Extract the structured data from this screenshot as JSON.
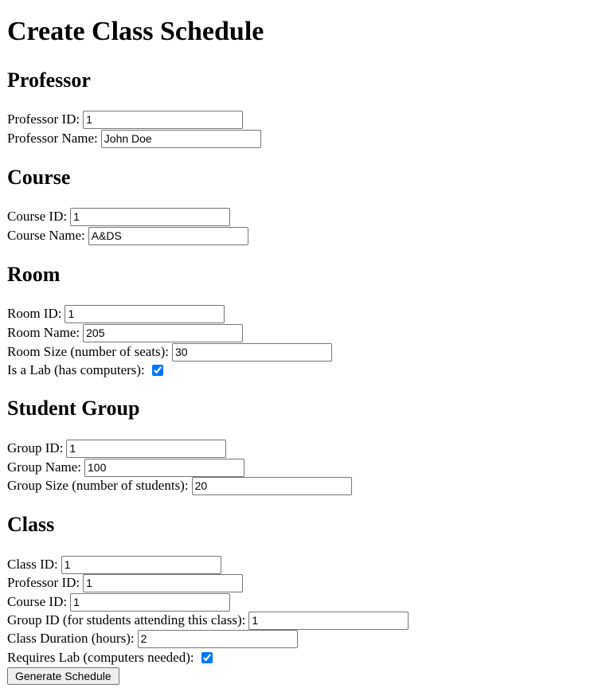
{
  "title": "Create Class Schedule",
  "professor": {
    "heading": "Professor",
    "id_label": "Professor ID:",
    "id_value": "1",
    "name_label": "Professor Name:",
    "name_value": "John Doe"
  },
  "course": {
    "heading": "Course",
    "id_label": "Course ID:",
    "id_value": "1",
    "name_label": "Course Name:",
    "name_value": "A&DS"
  },
  "room": {
    "heading": "Room",
    "id_label": "Room ID:",
    "id_value": "1",
    "name_label": "Room Name:",
    "name_value": "205",
    "size_label": "Room Size (number of seats):",
    "size_value": "30",
    "lab_label": "Is a Lab (has computers):",
    "lab_checked": true
  },
  "group": {
    "heading": "Student Group",
    "id_label": "Group ID:",
    "id_value": "1",
    "name_label": "Group Name:",
    "name_value": "100",
    "size_label": "Group Size (number of students):",
    "size_value": "20"
  },
  "class": {
    "heading": "Class",
    "id_label": "Class ID:",
    "id_value": "1",
    "professor_id_label": "Professor ID:",
    "professor_id_value": "1",
    "course_id_label": "Course ID:",
    "course_id_value": "1",
    "group_id_label": "Group ID (for students attending this class):",
    "group_id_value": "1",
    "duration_label": "Class Duration (hours):",
    "duration_value": "2",
    "requires_lab_label": "Requires Lab (computers needed):",
    "requires_lab_checked": true
  },
  "submit_label": "Generate Schedule",
  "colors": {
    "checkbox_accent": "#0075ff",
    "input_border": "#767676",
    "button_bg": "#efefef"
  }
}
